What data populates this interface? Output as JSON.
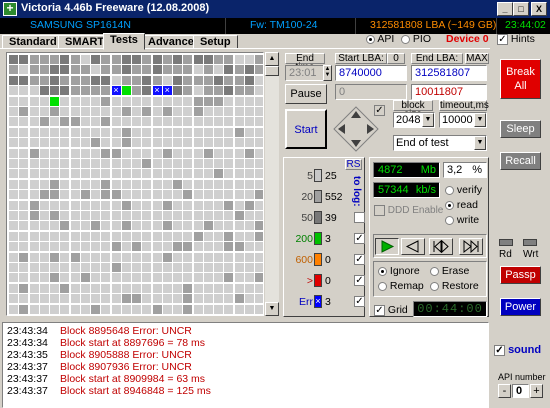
{
  "window": {
    "title": "Victoria 4.46b Freeware (12.08.2008)",
    "minimize": "_",
    "maximize": "□",
    "close": "X"
  },
  "infobar": {
    "model": "SAMSUNG SP1614N",
    "firmware": "Fw: TM100-24",
    "lba": "312581808 LBA (~149 GB)",
    "time": "23:44:02"
  },
  "tabs": [
    "Standard",
    "SMART",
    "Tests",
    "Advanced",
    "Setup"
  ],
  "api": {
    "api_label": "API",
    "pio_label": "PIO",
    "device": "Device 0",
    "hints_label": "Hints"
  },
  "controls": {
    "end_time_label": "End time",
    "end_time_value": "23:01",
    "start_lba_label": "Start LBA:",
    "start_lba_zero": "0",
    "start_lba_value": "8740000",
    "end_lba_label": "End LBA:",
    "end_lba_max": "MAX",
    "end_lba_value": "312581807",
    "pause_label": "Pause",
    "start_label": "Start",
    "current_lba_left": "0",
    "current_lba_right": "10011807",
    "block_size_label": "block size",
    "block_size_value": "2048",
    "timeout_label": "timeout,ms",
    "timeout_value": "10000",
    "end_action_value": "End of test"
  },
  "counters": {
    "rs_label": "RS",
    "to_log_label": "to log:",
    "rows": [
      {
        "label": "5",
        "value": "25",
        "color": "#c8c8c8",
        "checked": false,
        "show_chk": false
      },
      {
        "label": "20",
        "value": "552",
        "color": "#a0a0a0",
        "checked": false,
        "show_chk": false
      },
      {
        "label": "50",
        "value": "39",
        "color": "#787878",
        "checked": false,
        "show_chk": true
      },
      {
        "label": "200",
        "value": "3",
        "color": "#00c000",
        "checked": true,
        "show_chk": true
      },
      {
        "label": "600",
        "value": "0",
        "color": "#ff8000",
        "checked": true,
        "show_chk": true
      },
      {
        "label": ">",
        "value": "0",
        "color": "#e00000",
        "checked": true,
        "show_chk": true
      },
      {
        "label": "Err",
        "value": "3",
        "color": "#0000ff",
        "checked": true,
        "show_chk": true
      }
    ]
  },
  "stats": {
    "mb_value": "4872",
    "mb_unit": "Mb",
    "percent_value": "3,2",
    "percent_unit": "%",
    "speed_value": "57344",
    "speed_unit": "kb/s",
    "ddd_label": "DDD Enable",
    "verify_label": "verify",
    "read_label": "read",
    "write_label": "write",
    "ignore_label": "Ignore",
    "erase_label": "Erase",
    "remap_label": "Remap",
    "restore_label": "Restore",
    "grid_label": "Grid",
    "timer": "00:44:00"
  },
  "right": {
    "break_all": "Break\nAll",
    "sleep": "Sleep",
    "recall": "Recall",
    "rd": "Rd",
    "wrt": "Wrt",
    "passp": "Passp",
    "power": "Power",
    "sound": "sound",
    "api_number_label": "API number",
    "api_number_value": "0",
    "minus": "-",
    "plus": "+"
  },
  "log": [
    {
      "time": "23:43:34",
      "message": "Block 8895648 Error: UNCR"
    },
    {
      "time": "23:43:34",
      "message": "Block start at 8897696 = 78 ms"
    },
    {
      "time": "23:43:35",
      "message": "Block 8905888 Error: UNCR"
    },
    {
      "time": "23:43:37",
      "message": "Block 8907936 Error: UNCR"
    },
    {
      "time": "23:43:37",
      "message": "Block start at 8909984 = 63 ms"
    },
    {
      "time": "23:43:37",
      "message": "Block start at 8946848 = 125 ms"
    }
  ],
  "map_blocks": {
    "status_colors": {
      "ok": "#cfcfcf",
      "slow": "#a0a0a0",
      "slower": "#7a7a7a",
      "good_green": "#00e000",
      "error_blue": "#1010ff",
      "bad": "#e00000"
    },
    "special_cells": [
      {
        "row": 3,
        "col": 10,
        "status": "error_blue",
        "mark": "×"
      },
      {
        "row": 3,
        "col": 11,
        "status": "good_green",
        "mark": ""
      },
      {
        "row": 3,
        "col": 14,
        "status": "error_blue",
        "mark": "×"
      },
      {
        "row": 3,
        "col": 15,
        "status": "error_blue",
        "mark": "×"
      },
      {
        "row": 4,
        "col": 4,
        "status": "good_green",
        "mark": ""
      }
    ]
  }
}
